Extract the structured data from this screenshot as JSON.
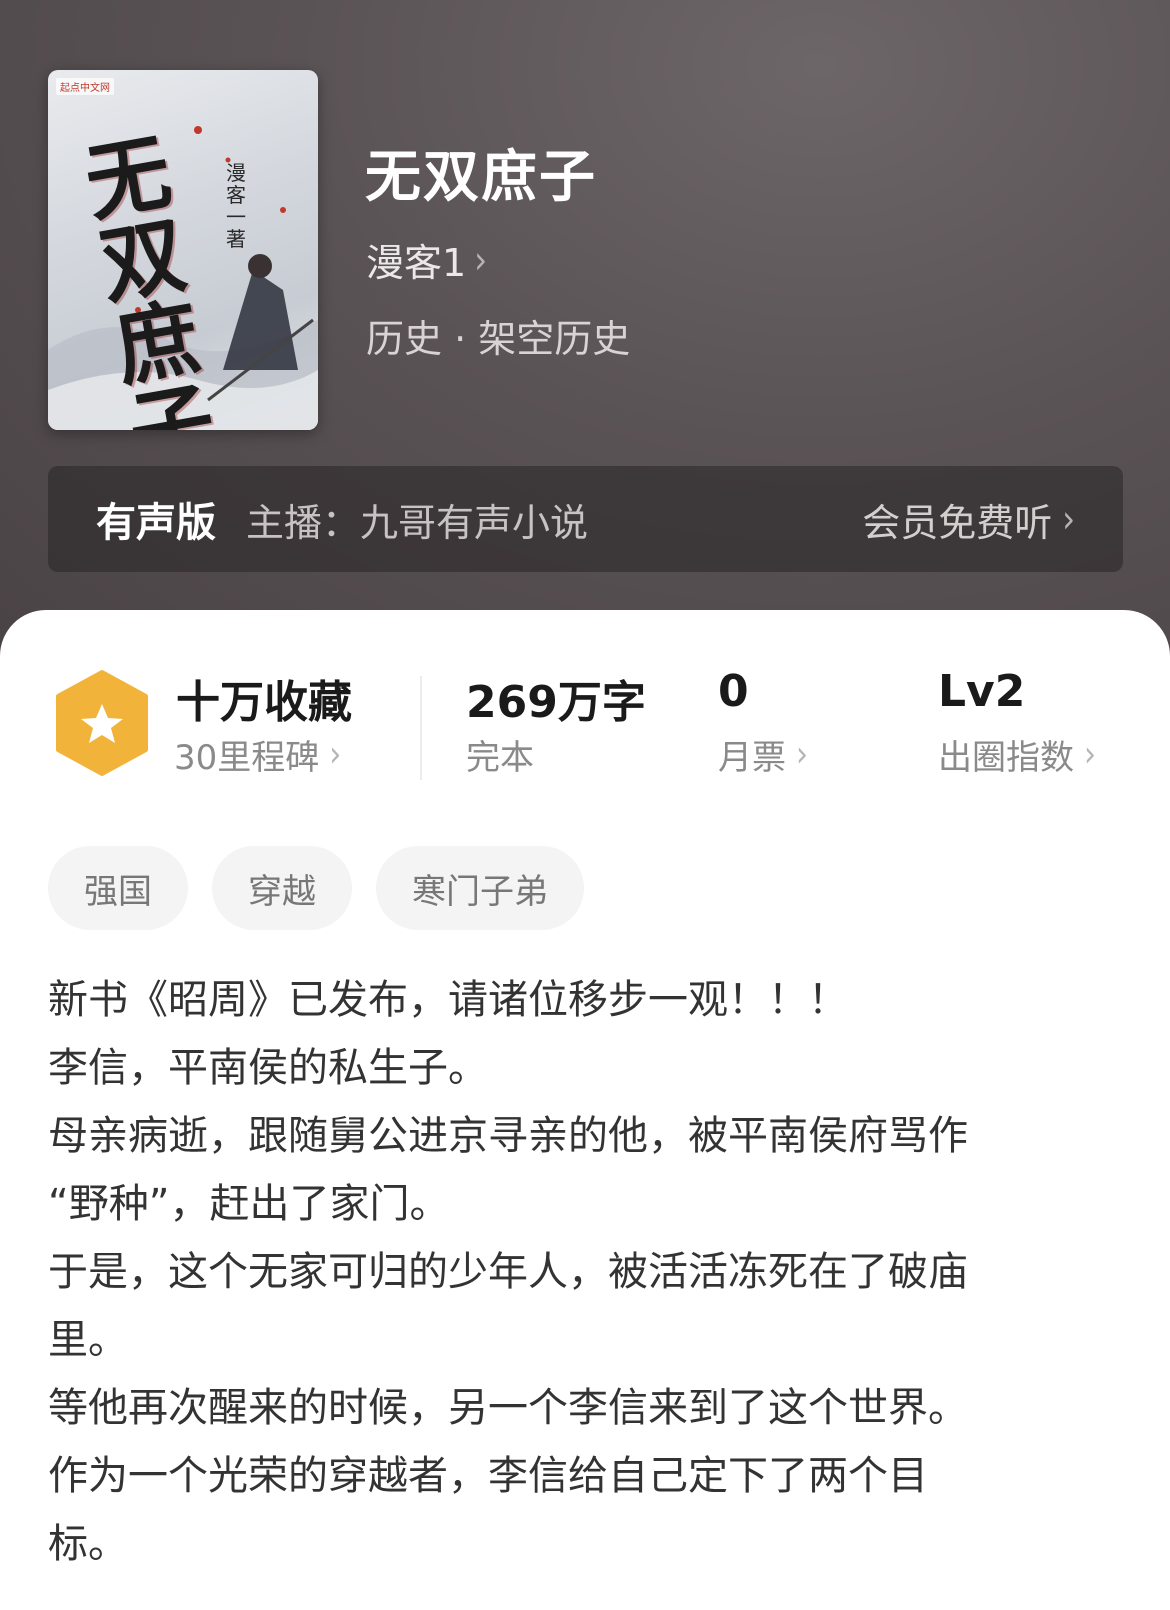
{
  "book": {
    "title": "无双庶子",
    "author": "漫客1",
    "genre": "历史 · 架空历史",
    "cover": {
      "brand": "起点中文网",
      "title_art": "无双庶子",
      "author_art": "漫客一著"
    }
  },
  "audio": {
    "label": "有声版",
    "host": "主播：九哥有声小说",
    "cta": "会员免费听"
  },
  "stats": {
    "collection_main": "十万收藏",
    "collection_sub": "30里程碑",
    "words_main": "269万字",
    "words_sub": "完本",
    "votes_main": "0",
    "votes_sub": "月票",
    "level_main": "Lv2",
    "level_sub": "出圈指数"
  },
  "tags": [
    "强国",
    "穿越",
    "寒门子弟"
  ],
  "description": [
    "新书《昭周》已发布，请诸位移步一观！！！",
    "李信，平南侯的私生子。",
    "母亲病逝，跟随舅公进京寻亲的他，被平南侯府骂作",
    "“野种”，赶出了家门。",
    "于是，这个无家可归的少年人，被活活冻死在了破庙",
    "里。",
    "等他再次醒来的时候，另一个李信来到了这个世界。",
    "作为一个光荣的穿越者，李信给自己定下了两个目",
    "标。"
  ],
  "colors": {
    "header_bg": "#5a5355",
    "badge": "#f2b33a",
    "sheet_bg": "#ffffff",
    "text_primary": "#1a1a1a",
    "text_secondary": "#8a8a8a"
  },
  "icons": {
    "chevron": "chevron-right-icon",
    "badge": "star-hexagon-icon"
  }
}
